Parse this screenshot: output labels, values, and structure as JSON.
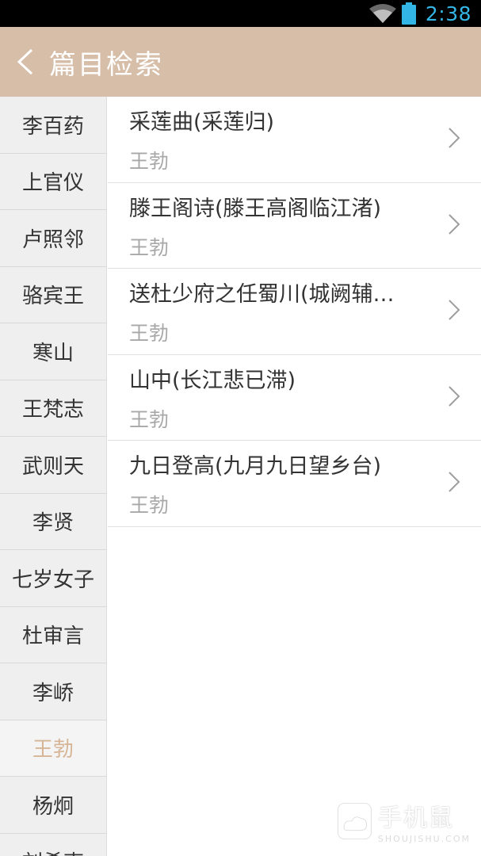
{
  "status_bar": {
    "time": "2:38",
    "icons": [
      "wifi-icon",
      "battery-icon"
    ]
  },
  "header": {
    "title": "篇目检索",
    "back_icon": "chevron-left-icon"
  },
  "sidebar": {
    "items": [
      {
        "label": "李百药"
      },
      {
        "label": "上官仪"
      },
      {
        "label": "卢照邻"
      },
      {
        "label": "骆宾王"
      },
      {
        "label": "寒山"
      },
      {
        "label": "王梵志"
      },
      {
        "label": "武则天"
      },
      {
        "label": "李贤"
      },
      {
        "label": "七岁女子"
      },
      {
        "label": "杜审言"
      },
      {
        "label": "李峤"
      },
      {
        "label": "王勃",
        "selected": true
      },
      {
        "label": "杨炯"
      },
      {
        "label": "刘希夷"
      }
    ]
  },
  "poems": [
    {
      "title": "采莲曲(采莲归)",
      "author": "王勃"
    },
    {
      "title": "滕王阁诗(滕王高阁临江渚)",
      "author": "王勃"
    },
    {
      "title": "送杜少府之任蜀川(城阙辅…",
      "author": "王勃"
    },
    {
      "title": "山中(长江悲已滞)",
      "author": "王勃"
    },
    {
      "title": "九日登高(九月九日望乡台)",
      "author": "王勃"
    }
  ],
  "watermark": {
    "cn": "手机鼠",
    "en": "SHOUJISHU.COM"
  },
  "colors": {
    "app_bar": "#d6bea9",
    "selected_text": "#d6b596",
    "clock": "#33b5e5"
  }
}
